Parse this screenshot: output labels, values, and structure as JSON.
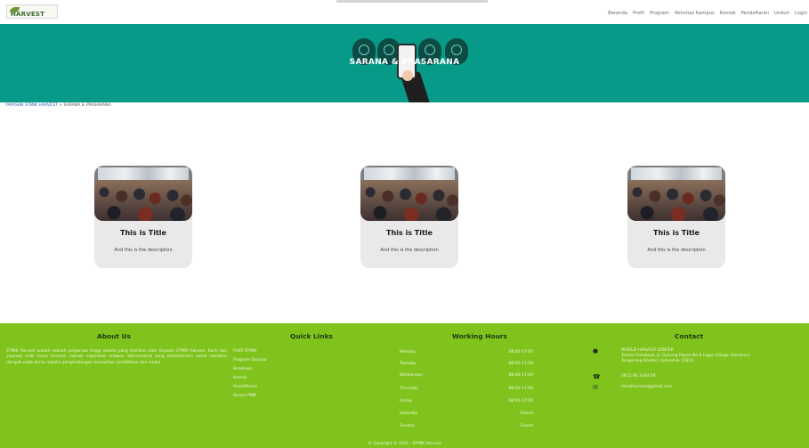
{
  "header": {
    "logo_text": "HARVEST",
    "nav": [
      "Beranda",
      "Profil",
      "Program",
      "Aktivitas Kampus",
      "Kontak",
      "Pendaftaran",
      "Unduh",
      "Login"
    ]
  },
  "hero": {
    "title": "SARANA & PRASARANA"
  },
  "breadcrumb": {
    "link": "YAYASAN STMIK HARVEST",
    "separator": " > ",
    "current": "SARANA & PRASARANA"
  },
  "cards": [
    {
      "title": "This is Title",
      "description": "And this is the description"
    },
    {
      "title": "This is Title",
      "description": "And this is the description"
    },
    {
      "title": "This is Title",
      "description": "And this is the description"
    }
  ],
  "footer": {
    "about": {
      "heading": "About Us",
      "text": "STMIK Harvest adalah sebuah perguruan tinggi swasta yang didirikan oleh Yayasan STMIK Harvest. Kami dan yayasan milik dunia Harvest, sebuah organisasi relawan internasional yang berkomitmen untuk memberi dampak pada dunia melalui pengembangan komunitas, pendidikan dan media."
    },
    "quick_links": {
      "heading": "Quick Links",
      "items": [
        "Profil STMIK",
        "Program Sarjana",
        "Beasiswa",
        "Kontak",
        "Pendaftaran",
        "Brosur PMB"
      ]
    },
    "working_hours": {
      "heading": "Working Hours",
      "rows": [
        {
          "day": "Monday",
          "time": "08:00-17:00"
        },
        {
          "day": "Tuesday",
          "time": "08:00-17:00"
        },
        {
          "day": "Wednesday",
          "time": "08:00-17:00"
        },
        {
          "day": "Thursday",
          "time": "08:00-17:00"
        },
        {
          "day": "Friday",
          "time": "08:00-17:00"
        },
        {
          "day": "Saturday",
          "time": "Closed"
        },
        {
          "day": "Sunday",
          "time": "Closed"
        }
      ]
    },
    "contact": {
      "heading": "Contact",
      "address_1": "WORLD HARVEST CENTER",
      "address_2": "Taman Himalaya, Jl. Gunung Papan No.6 Lippo Village, Karawaci,",
      "address_3": "Tangerang Banten, Indonesia 15811",
      "phone": "0812 96 3344 06",
      "email": "stmikharvest@gmail.com"
    },
    "copyright": "© Copyright © 2021 - STMIK Harvest"
  }
}
